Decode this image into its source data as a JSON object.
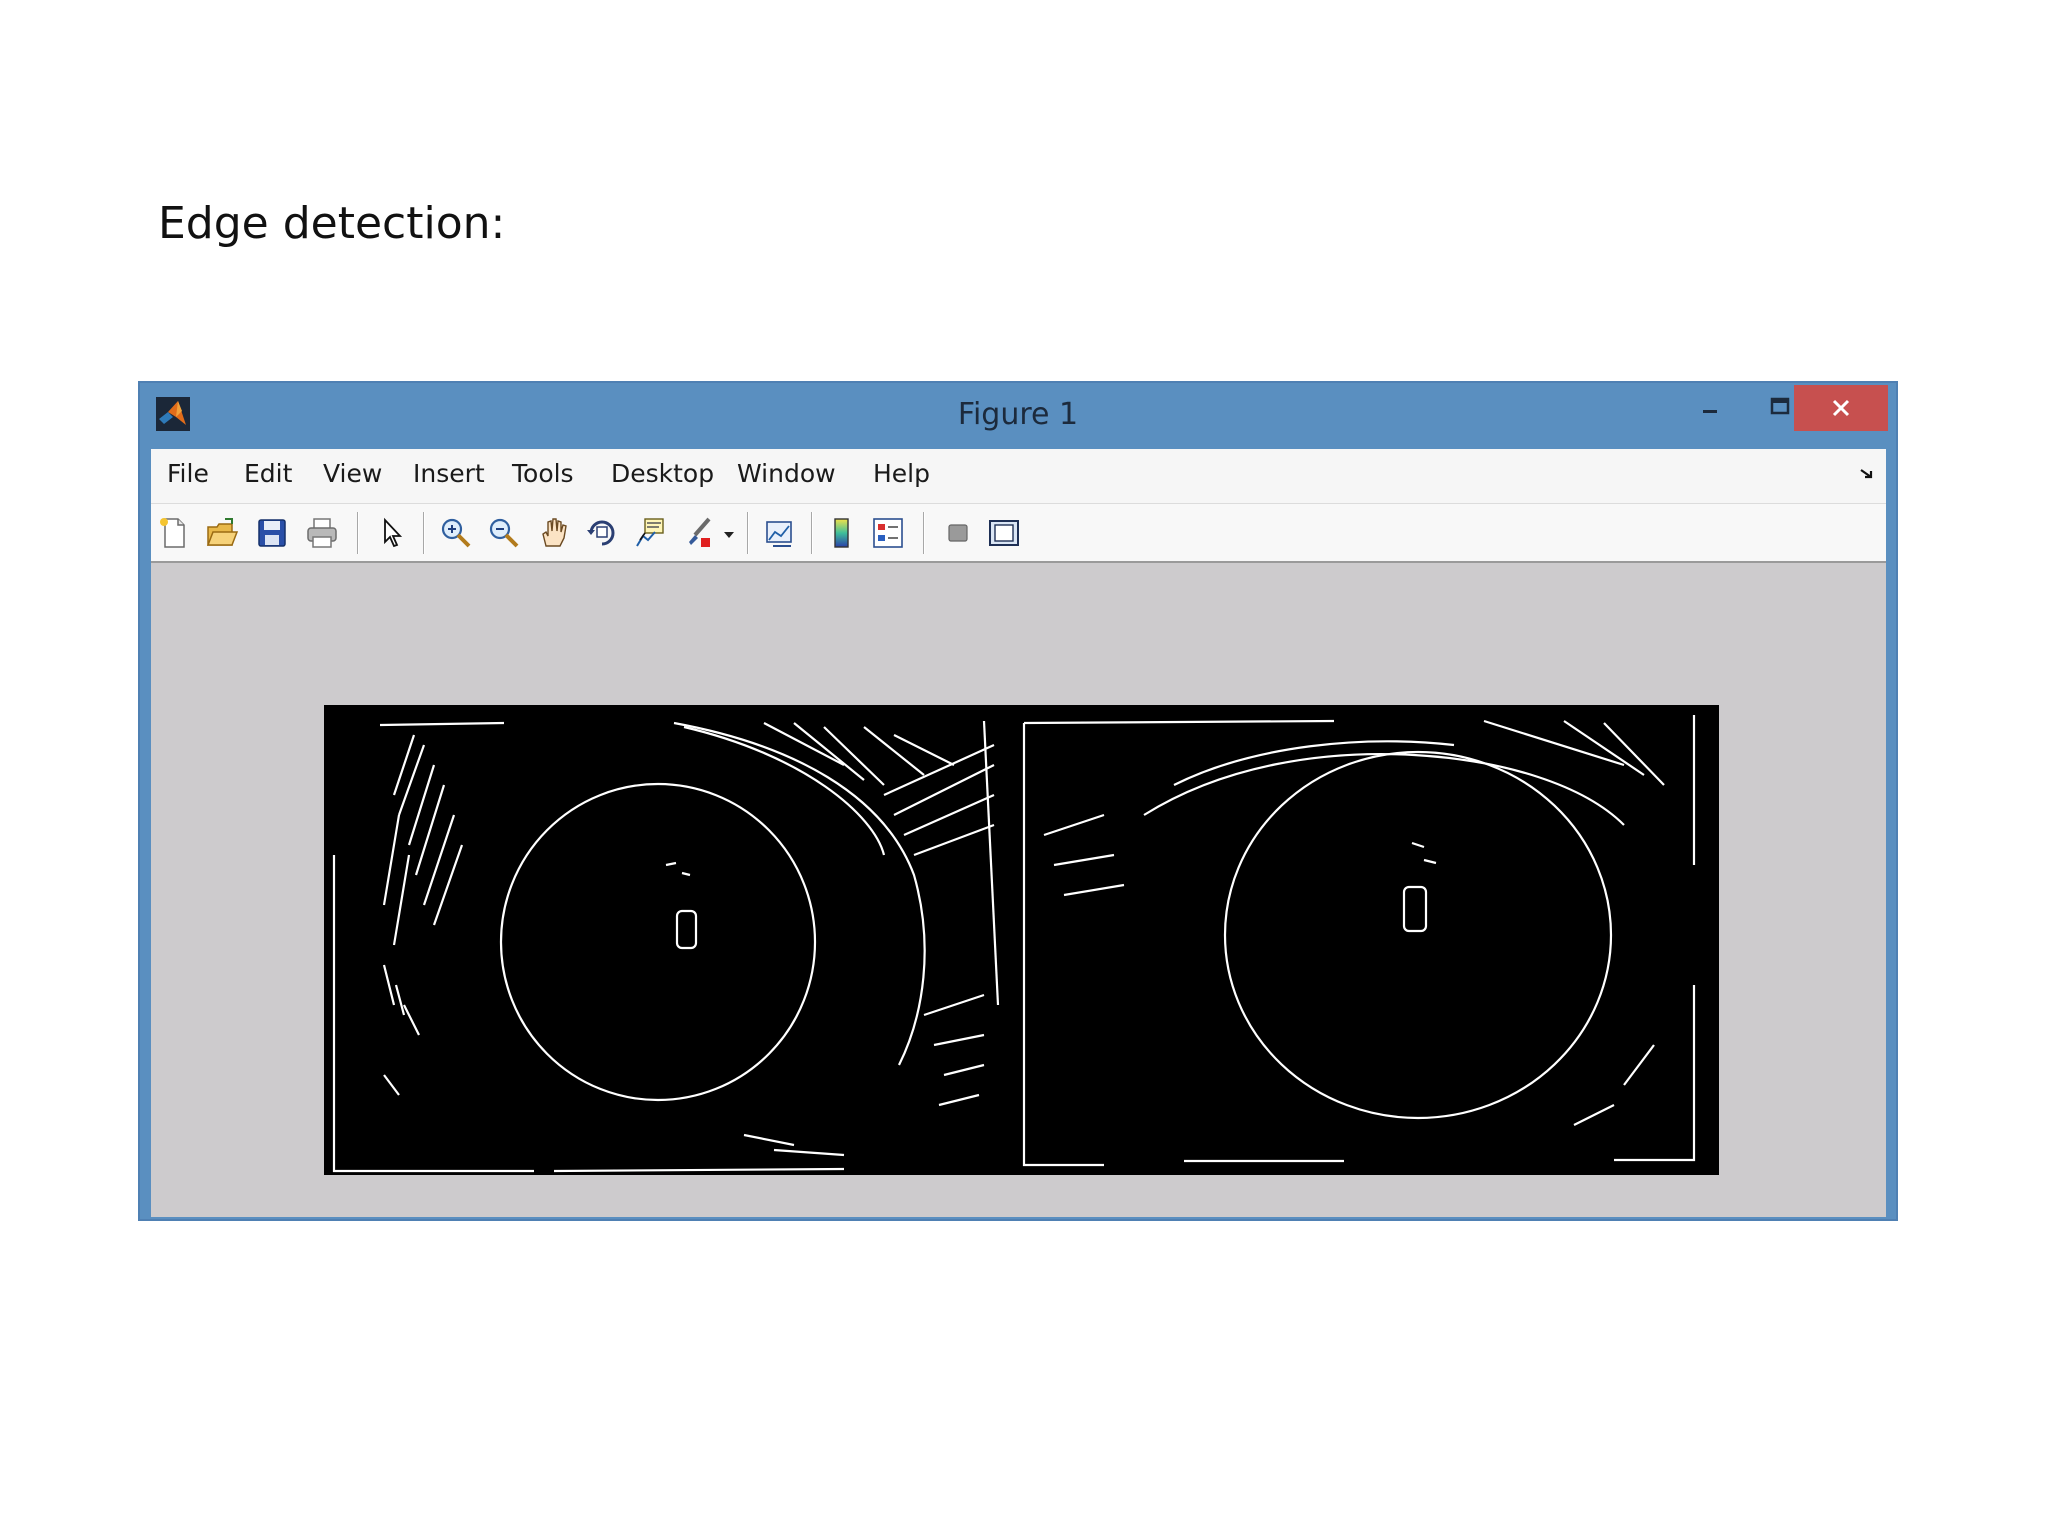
{
  "slide": {
    "title": "Edge detection:"
  },
  "window": {
    "title": "Figure 1",
    "controls": [
      "minimize",
      "maximize",
      "close"
    ]
  },
  "menu": {
    "items": [
      "File",
      "Edit",
      "View",
      "Insert",
      "Tools",
      "Desktop",
      "Window",
      "Help"
    ]
  },
  "toolbar": {
    "icons": [
      "new-figure-icon",
      "open-file-icon",
      "save-icon",
      "print-icon",
      "edit-plot-arrow-icon",
      "zoom-in-icon",
      "zoom-out-icon",
      "pan-hand-icon",
      "rotate-3d-icon",
      "data-cursor-icon",
      "brush-icon",
      "link-plot-icon",
      "insert-colorbar-icon",
      "insert-legend-icon",
      "hide-plot-tools-icon",
      "show-plot-tools-icon"
    ]
  },
  "colors": {
    "window_frame": "#5a8fc0",
    "close_button": "#c7504f",
    "figure_background": "#cdcbcd",
    "image_background": "#000000",
    "edge_color": "#ffffff"
  },
  "images": [
    {
      "name": "edge-map-left"
    },
    {
      "name": "edge-map-right"
    }
  ]
}
